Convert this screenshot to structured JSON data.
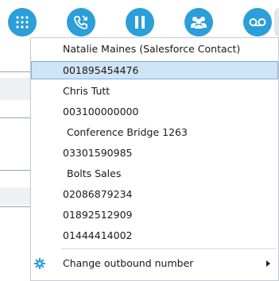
{
  "toolbar": {
    "buttons": [
      {
        "icon": "dialpad-icon"
      },
      {
        "icon": "call-icon"
      },
      {
        "icon": "pause-icon"
      },
      {
        "icon": "conference-icon"
      },
      {
        "icon": "voicemail-icon"
      }
    ],
    "accent_color": "#2a9fd8"
  },
  "menu": {
    "items": [
      {
        "label": "Natalie Maines (Salesforce Contact)",
        "selected": false
      },
      {
        "label": "001895454476",
        "selected": true
      },
      {
        "label": "Chris Tutt",
        "selected": false
      },
      {
        "label": "003100000000",
        "selected": false
      },
      {
        "label": "Conference Bridge 1263",
        "selected": false
      },
      {
        "label": "03301590985",
        "selected": false
      },
      {
        "label": "Bolts Sales",
        "selected": false
      },
      {
        "label": "02086879234",
        "selected": false
      },
      {
        "label": "01892512909",
        "selected": false
      },
      {
        "label": "01444414002",
        "selected": false
      }
    ],
    "footer": {
      "label": "Change outbound number",
      "icon": "gear-icon"
    }
  }
}
